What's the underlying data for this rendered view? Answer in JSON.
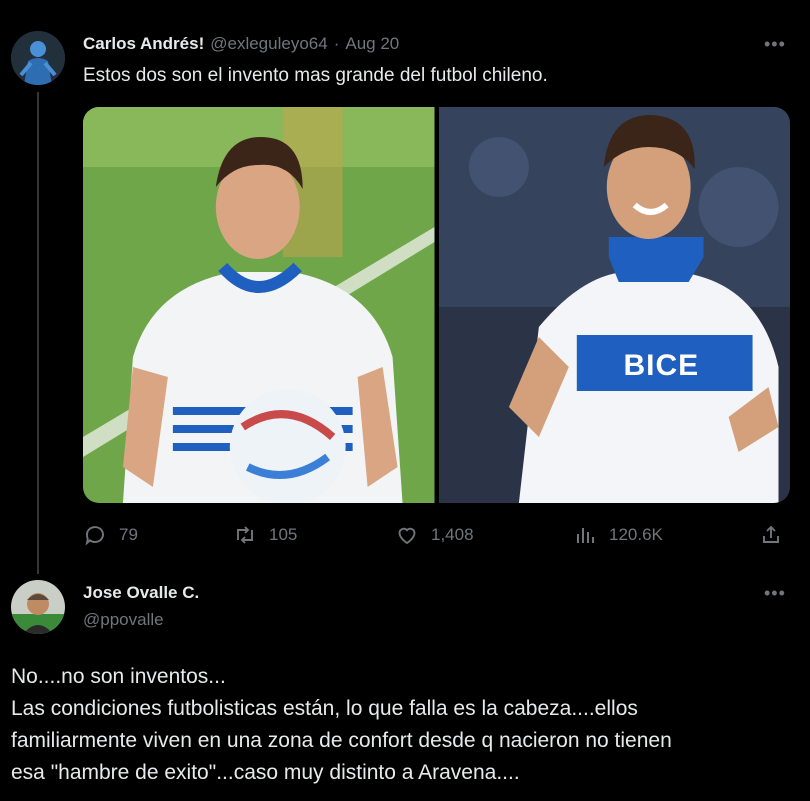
{
  "tweet": {
    "author_name": "Carlos Andrés!",
    "author_handle": "@exleguleyo64",
    "separator": "·",
    "date": "Aug 20",
    "more_label": "•••",
    "text": "Estos dos son el invento mas grande del futbol chileno.",
    "images": [
      {
        "icon": "photo-player-1"
      },
      {
        "icon": "photo-player-2",
        "sponsor_text": "BICE"
      }
    ],
    "actions": {
      "replies": "79",
      "retweets": "105",
      "likes": "1,408",
      "views": "120.6K"
    }
  },
  "reply": {
    "author_name": "Jose Ovalle C.",
    "author_handle": "@ppovalle",
    "more_label": "•••",
    "lines": [
      "No....no son inventos...",
      "Las condiciones futbolisticas están, lo que falla es la cabeza....ellos",
      "familiarmente viven en una zona de confort desde q nacieron no tienen",
      "esa \"hambre de exito\"...caso muy distinto a Aravena...."
    ]
  },
  "colors": {
    "background": "#000000",
    "text": "#e7e9ea",
    "muted": "#71767b",
    "thread_line": "#333639",
    "jersey_blue": "#1f5fbf"
  }
}
